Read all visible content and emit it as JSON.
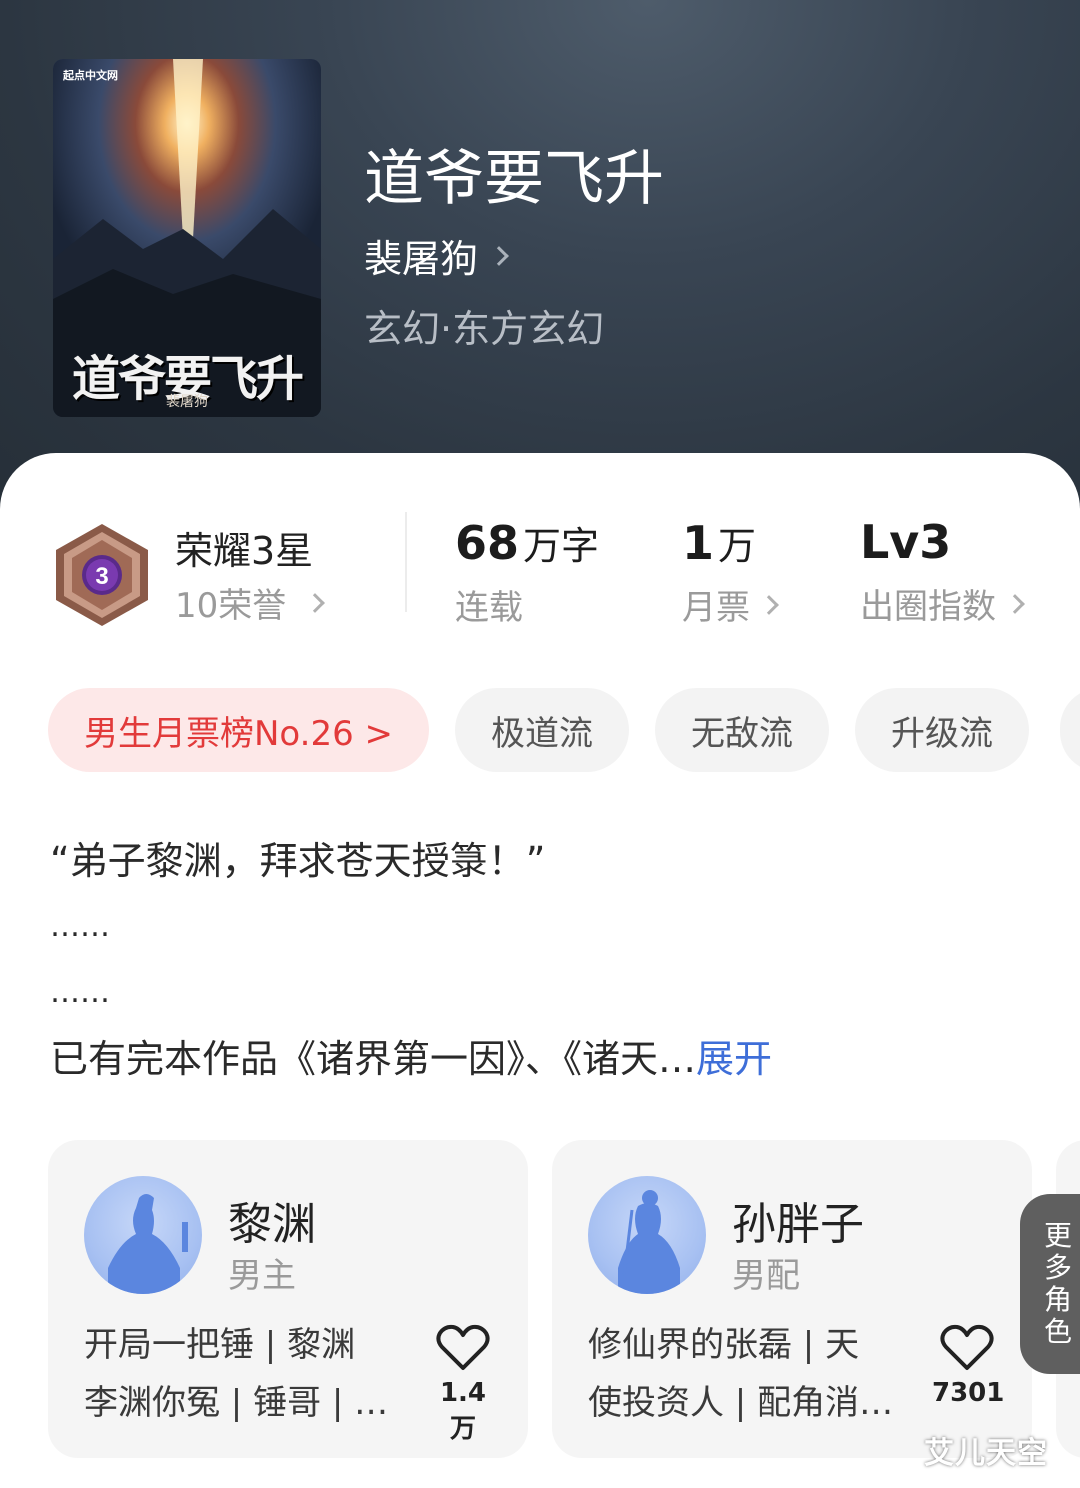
{
  "cover": {
    "publisher": "起点中文网",
    "title": "道爷要飞升",
    "author": "裴屠狗"
  },
  "book": {
    "title": "道爷要飞升",
    "author": "裴屠狗",
    "genre": "玄幻·东方玄幻"
  },
  "honor": {
    "level_badge": "3",
    "title": "荣耀3星",
    "subtitle": "10荣誉"
  },
  "stats": [
    {
      "value": "68",
      "unit": "万字",
      "label": "连载"
    },
    {
      "value": "1",
      "unit": "万",
      "label": "月票"
    },
    {
      "value": "Lv3",
      "unit": "",
      "label": "出圈指数"
    }
  ],
  "tags": {
    "rank": "男生月票榜No.26 >",
    "items": [
      "极道流",
      "无敌流",
      "升级流"
    ]
  },
  "description": {
    "line1": "“弟子黎渊，拜求苍天授箓！”",
    "line2": "……",
    "line3": "……",
    "line4": "已有完本作品《诸界第一因》、《诸天…",
    "expand": "展开"
  },
  "roles": [
    {
      "name": "黎渊",
      "type": "男主",
      "desc_line1": "开局一把锤 | 黎渊",
      "desc_line2": "李渊你冤 | 锤哥 | …",
      "likes": "1.4万"
    },
    {
      "name": "孙胖子",
      "type": "男配",
      "desc_line1": "修仙界的张磊 | 天",
      "desc_line2": "使投资人 | 配角消…",
      "likes": "7301"
    }
  ],
  "more_roles": "更多角色",
  "watermark": "艾儿天空"
}
